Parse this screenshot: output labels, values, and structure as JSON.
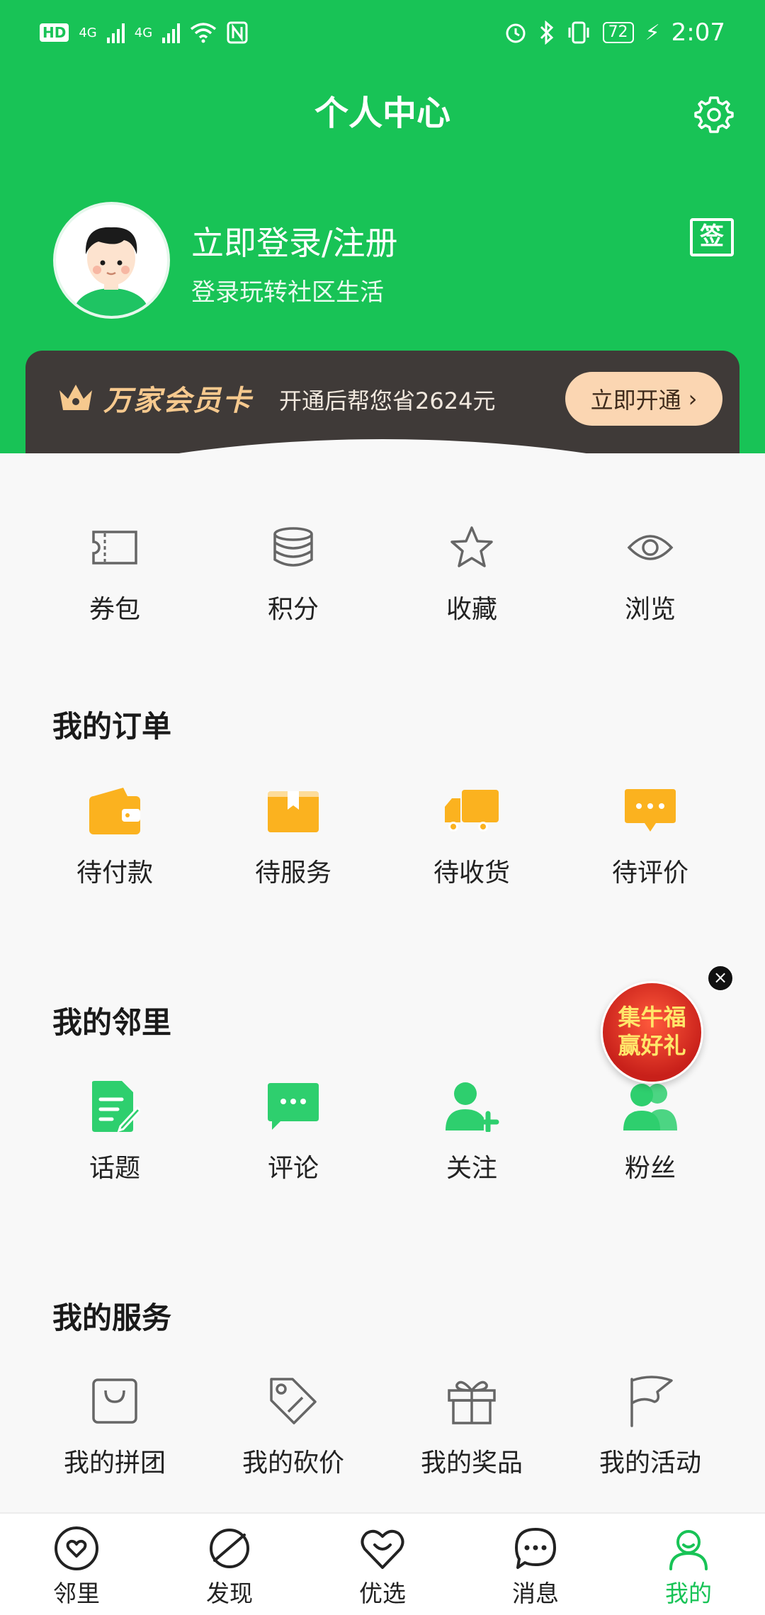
{
  "status_bar": {
    "hd": "HD",
    "net1": "4G",
    "net2": "4G",
    "battery": "72",
    "time": "2:07"
  },
  "header": {
    "title": "个人中心",
    "settings_icon": "gear-icon"
  },
  "profile": {
    "login_text": "立即登录/注册",
    "subtitle": "登录玩转社区生活",
    "sign_in_label": "签"
  },
  "vip": {
    "name": "万家会员卡",
    "desc": "开通后帮您省2624元",
    "button": "立即开通"
  },
  "quick": [
    {
      "label": "券包",
      "icon": "coupon-icon"
    },
    {
      "label": "积分",
      "icon": "coins-icon"
    },
    {
      "label": "收藏",
      "icon": "star-icon"
    },
    {
      "label": "浏览",
      "icon": "eye-icon"
    }
  ],
  "orders": {
    "title": "我的订单",
    "items": [
      {
        "label": "待付款",
        "icon": "wallet-icon"
      },
      {
        "label": "待服务",
        "icon": "box-icon"
      },
      {
        "label": "待收货",
        "icon": "truck-icon"
      },
      {
        "label": "待评价",
        "icon": "comment-icon"
      }
    ]
  },
  "neighbors": {
    "title": "我的邻里",
    "items": [
      {
        "label": "话题",
        "icon": "edit-doc-icon"
      },
      {
        "label": "评论",
        "icon": "chat-icon"
      },
      {
        "label": "关注",
        "icon": "add-user-icon"
      },
      {
        "label": "粉丝",
        "icon": "fans-icon"
      }
    ]
  },
  "services": {
    "title": "我的服务",
    "items": [
      {
        "label": "我的拼团",
        "icon": "bag-icon"
      },
      {
        "label": "我的砍价",
        "icon": "discount-tag-icon"
      },
      {
        "label": "我的奖品",
        "icon": "gift-icon"
      },
      {
        "label": "我的活动",
        "icon": "flag-icon"
      }
    ]
  },
  "promo": {
    "line1": "集牛福",
    "line2": "赢好礼"
  },
  "tabs": [
    {
      "label": "邻里",
      "icon": "neighbor-heart-icon"
    },
    {
      "label": "发现",
      "icon": "planet-icon"
    },
    {
      "label": "优选",
      "icon": "smile-heart-icon"
    },
    {
      "label": "消息",
      "icon": "message-icon"
    },
    {
      "label": "我的",
      "icon": "user-icon",
      "active": true
    }
  ],
  "colors": {
    "brand_green": "#18c356",
    "order_orange": "#fbb21f",
    "neighbor_green": "#2ecf6e",
    "vip_bg": "#3f3a38",
    "vip_gold": "#f6c98e"
  }
}
